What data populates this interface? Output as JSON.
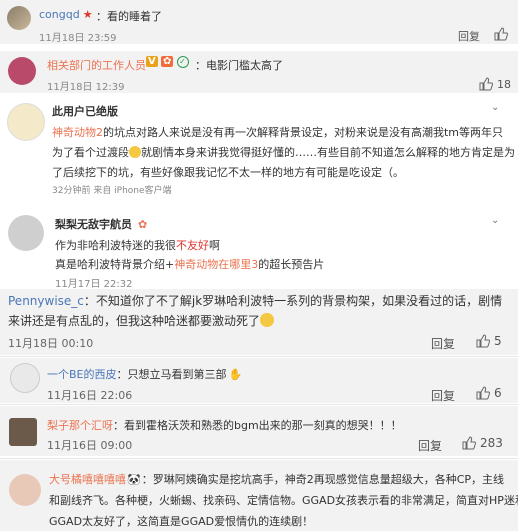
{
  "c1": {
    "name": "congqd",
    "text": "：看的睡着了",
    "time": "11月18日 23:59",
    "reply": "回复"
  },
  "c2": {
    "name": "相关部门的工作人员",
    "text": "：电影门槛太高了",
    "time": "11月18日 12:39",
    "likes": "18"
  },
  "c3": {
    "name": "此用户已绝版",
    "link": "神奇动物2",
    "text1": "的坑点对路人来说是没有再一次解释背景设定，对粉来说是没有高潮我tm等两年只",
    "text2a": "为了看个过渡段",
    "text2b": "就剧情本身来讲我觉得挺好懂的……有些目前不知道怎么解释的地方肯定是为",
    "text3": "了后续挖下的坑，有些好像跟我记忆不太一样的地方有可能是吃设定（。",
    "meta": "32分钟前 来自 iPhone客户端"
  },
  "c4": {
    "name": "梨梨无敌宇航员",
    "line1a": "作为非哈利波特迷的我很",
    "line1b": "不友好",
    "line1c": "啊",
    "line2a": "真是哈利波特背景介绍+",
    "line2b": "神奇动物在哪里3",
    "line2c": "的超长预告片",
    "time": "11月17日 22:32"
  },
  "c5": {
    "name": "Pennywise_c",
    "text1": "：不知道你了不了解jk罗琳哈利波特一系列的背景构架，如果没看过的话，剧情",
    "text2": "来讲还是有点乱的，但我这种哈迷都要激动死了",
    "time": "11月18日 00:10",
    "reply": "回复",
    "likes": "5"
  },
  "c6": {
    "name": "一个BE的西皮",
    "text": "：只想立马看到第三部",
    "time": "11月16日 22:06",
    "reply": "回复",
    "likes": "6"
  },
  "c7": {
    "name": "梨子那个汇呀",
    "text": "：看到霍格沃茨和熟悉的bgm出来的那一刻真的想哭！！！",
    "time": "11月16日 09:00",
    "reply": "回复",
    "likes": "283"
  },
  "c8": {
    "name": "大号橘嘻嘻嘻嘻",
    "text1": "：罗琳阿姨确实是挖坑高手，神奇2再现感觉信息量超级大，各种CP，主线",
    "text2": "和副线齐飞。各种梗，火蜥蜴、找亲码、定情信物。GGAD女孩表示看的非常满足，简直对HP迷和",
    "text3": "GGAD太友好了，这简直是GGAD爱恨情仇的连续剧！"
  },
  "colors": {
    "orange": "#eb7350",
    "blue": "#4a76b8",
    "gray_bg": "#f2f2f2"
  }
}
